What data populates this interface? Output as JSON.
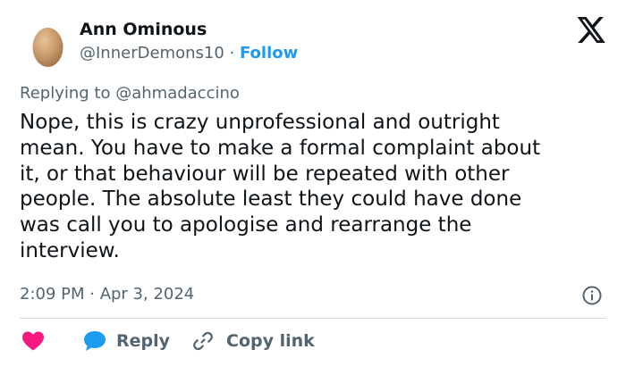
{
  "colors": {
    "text": "#0f1419",
    "muted": "#536471",
    "link_blue": "#1d9bf0",
    "heart_pink": "#f91880",
    "divider": "#cfd9de"
  },
  "author": {
    "name": "Ann Ominous",
    "handle": "@InnerDemons10",
    "separator": "·",
    "follow_label": "Follow",
    "avatar_icon": "egg-avatar"
  },
  "brand_icon": "x-logo-icon",
  "reply_context": {
    "prefix": "Replying to",
    "mention": "@ahmadaccino"
  },
  "tweet": {
    "lines": [
      "Nope, this is crazy unprofessional and outright",
      "mean. You have to make a formal complaint about",
      "it, or that behaviour will be repeated with other",
      "people. The absolute least they could have done",
      "was call you to apologise and rearrange the",
      "interview."
    ],
    "timestamp": "2:09 PM · Apr 3, 2024"
  },
  "actions": {
    "like_icon": "heart-icon",
    "reply_label": "Reply",
    "reply_icon": "speech-bubble-icon",
    "copy_label": "Copy link",
    "copy_icon": "link-icon",
    "info_icon": "info-icon"
  }
}
